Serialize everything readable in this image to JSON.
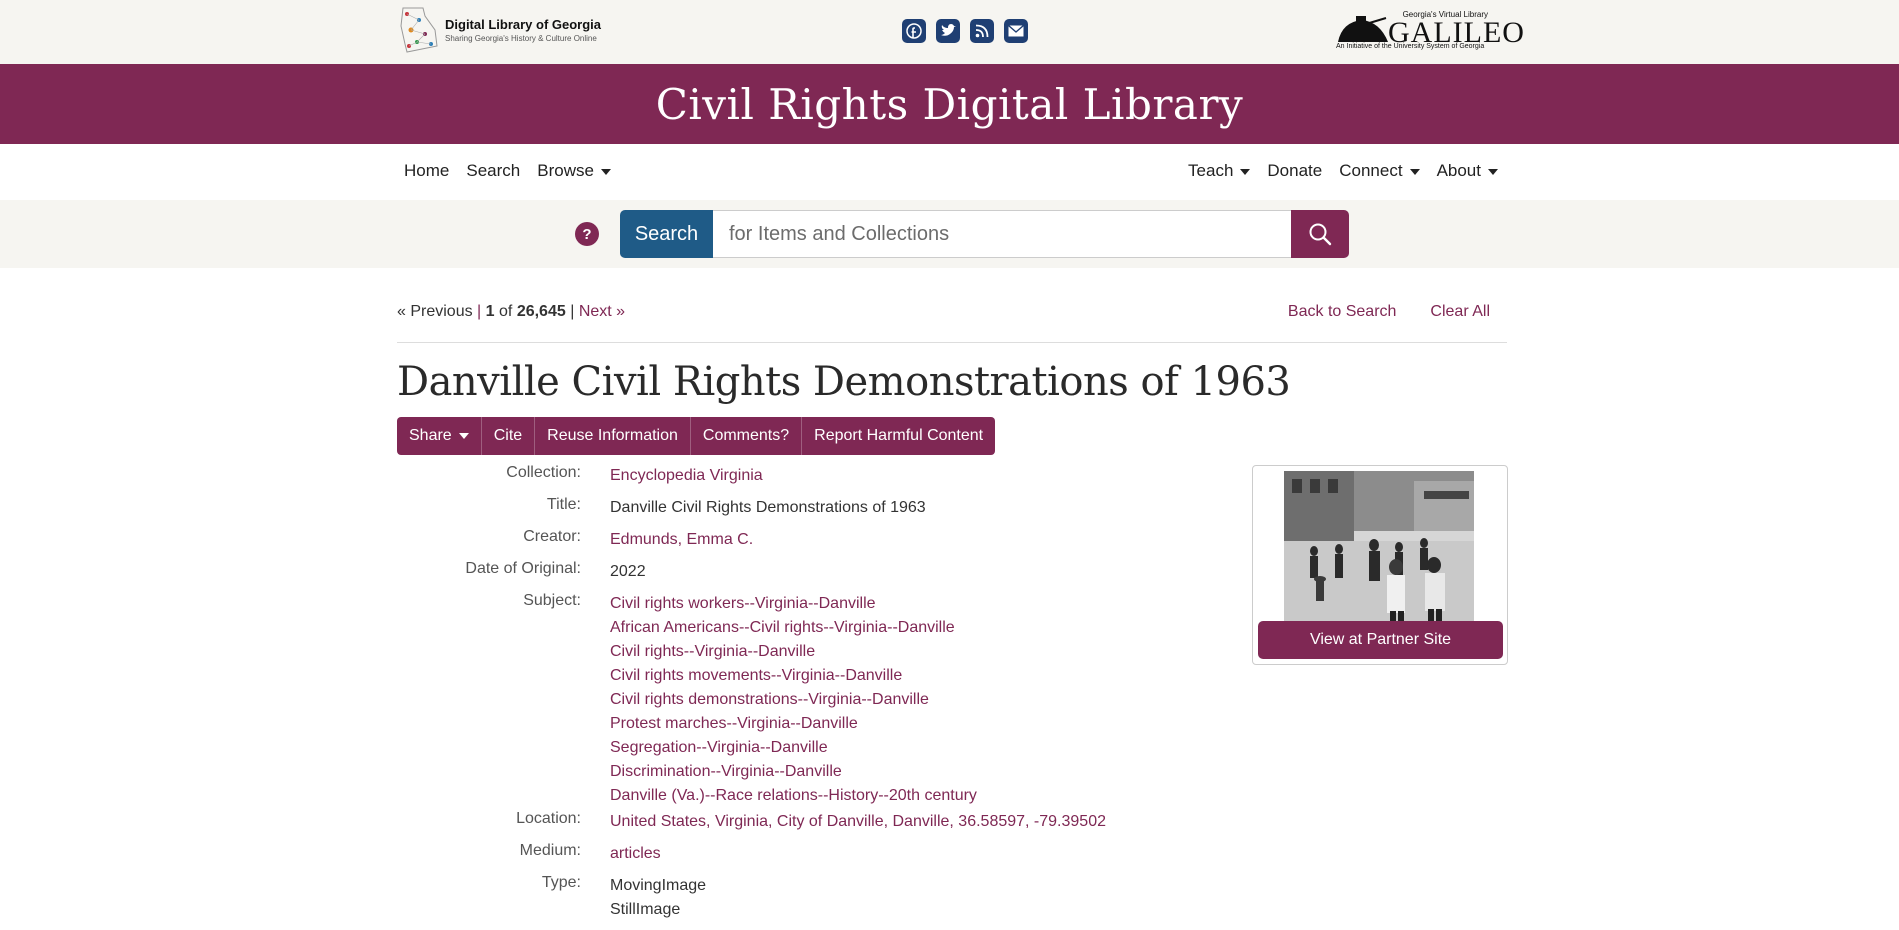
{
  "topbar": {
    "dlg_title": "Digital Library of Georgia",
    "dlg_tagline": "Sharing Georgia's History & Culture Online",
    "social_icons": [
      "facebook-icon",
      "twitter-icon",
      "rss-icon",
      "email-icon"
    ],
    "galileo_top": "Georgia's Virtual Library",
    "galileo_name": "GALILEO",
    "galileo_sub": "An Initiative of the University System of Georgia"
  },
  "banner": {
    "title": "Civil Rights Digital Library",
    "color": "#7f2854"
  },
  "nav": {
    "left": [
      {
        "label": "Home",
        "dropdown": false
      },
      {
        "label": "Search",
        "dropdown": false
      },
      {
        "label": "Browse",
        "dropdown": true
      }
    ],
    "right": [
      {
        "label": "Teach",
        "dropdown": true
      },
      {
        "label": "Donate",
        "dropdown": false
      },
      {
        "label": "Connect",
        "dropdown": true
      },
      {
        "label": "About",
        "dropdown": true
      }
    ]
  },
  "search": {
    "help_label": "?",
    "label": "Search",
    "placeholder": "for Items and Collections",
    "value": "",
    "button_icon": "magnifier-icon"
  },
  "pager": {
    "previous": "« Previous",
    "sep": "|",
    "current": "1",
    "of": "of",
    "total": "26,645",
    "next": "Next »",
    "back_to_search": "Back to Search",
    "clear_all": "Clear All"
  },
  "record": {
    "title": "Danville Civil Rights Demonstrations of 1963",
    "actions": [
      {
        "label": "Share",
        "dropdown": true
      },
      {
        "label": "Cite",
        "dropdown": false
      },
      {
        "label": "Reuse Information",
        "dropdown": false
      },
      {
        "label": "Comments?",
        "dropdown": false
      },
      {
        "label": "Report Harmful Content",
        "dropdown": false
      }
    ],
    "fields": [
      {
        "label": "Collection:",
        "values": [
          "Encyclopedia Virginia"
        ],
        "link": true
      },
      {
        "label": "Title:",
        "values": [
          "Danville Civil Rights Demonstrations of 1963"
        ],
        "link": false
      },
      {
        "label": "Creator:",
        "values": [
          "Edmunds, Emma C."
        ],
        "link": true
      },
      {
        "label": "Date of Original:",
        "values": [
          "2022"
        ],
        "link": false
      },
      {
        "label": "Subject:",
        "values": [
          "Civil rights workers--Virginia--Danville",
          "African Americans--Civil rights--Virginia--Danville",
          "Civil rights--Virginia--Danville",
          "Civil rights movements--Virginia--Danville",
          "Civil rights demonstrations--Virginia--Danville",
          "Protest marches--Virginia--Danville",
          "Segregation--Virginia--Danville",
          "Discrimination--Virginia--Danville",
          "Danville (Va.)--Race relations--History--20th century"
        ],
        "link": true
      },
      {
        "label": "Location:",
        "values": [
          "United States, Virginia, City of Danville, Danville, 36.58597, -79.39502"
        ],
        "link": true
      },
      {
        "label": "Medium:",
        "values": [
          "articles"
        ],
        "link": true
      },
      {
        "label": "Type:",
        "values": [
          "MovingImage",
          "StillImage"
        ],
        "link": false
      }
    ],
    "partner_button": "View at Partner Site"
  }
}
